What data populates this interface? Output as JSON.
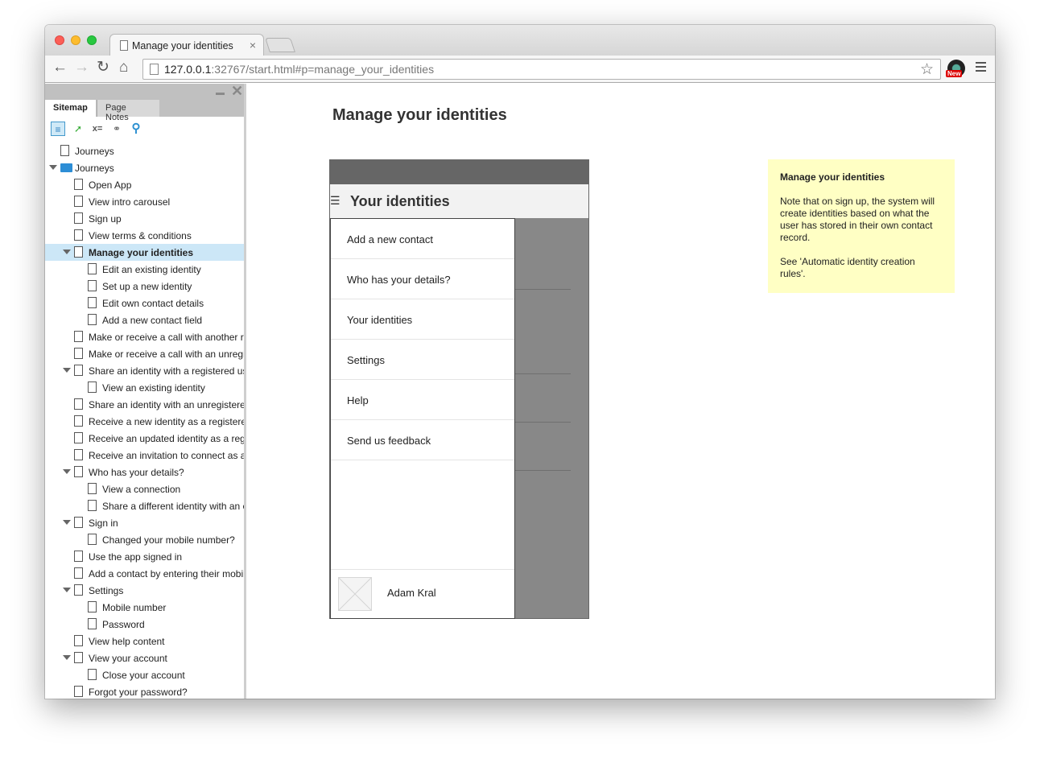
{
  "browser": {
    "tab_title": "Manage your identities",
    "tab_close": "×",
    "url_host": "127.0.0.1",
    "url_rest": ":32767/start.html#p=manage_your_identities",
    "back": "←",
    "forward": "→",
    "reload": "↻",
    "home": "⌂",
    "bookmark": "☆",
    "extension_badge": "New"
  },
  "sidebar": {
    "close": "✕",
    "tabs": [
      "Sitemap",
      "Page Notes"
    ],
    "tools": {
      "vars": "x=",
      "link": "⚭",
      "search": "⚲",
      "pages": "≡",
      "cursor": "➚"
    },
    "tree": [
      {
        "label": "Journeys",
        "level": 0,
        "icon": "page",
        "arrow": false
      },
      {
        "label": "Journeys",
        "level": 0,
        "icon": "folder",
        "arrow": true
      },
      {
        "label": "Open App",
        "level": 1,
        "icon": "page",
        "arrow": false
      },
      {
        "label": "View intro carousel",
        "level": 1,
        "icon": "page",
        "arrow": false
      },
      {
        "label": "Sign up",
        "level": 1,
        "icon": "page",
        "arrow": false
      },
      {
        "label": "View terms & conditions",
        "level": 1,
        "icon": "page",
        "arrow": false
      },
      {
        "label": "Manage your identities",
        "level": 1,
        "icon": "page",
        "arrow": true,
        "selected": true
      },
      {
        "label": "Edit an existing identity",
        "level": 2,
        "icon": "page",
        "arrow": false
      },
      {
        "label": "Set up a new identity",
        "level": 2,
        "icon": "page",
        "arrow": false
      },
      {
        "label": "Edit own contact details",
        "level": 2,
        "icon": "page",
        "arrow": false
      },
      {
        "label": "Add a new contact field",
        "level": 2,
        "icon": "page",
        "arrow": false
      },
      {
        "label": "Make or receive a call with another re",
        "level": 1,
        "icon": "page",
        "arrow": false
      },
      {
        "label": "Make or receive a call with an unregis",
        "level": 1,
        "icon": "page",
        "arrow": false
      },
      {
        "label": "Share an identity with a registered us",
        "level": 1,
        "icon": "page",
        "arrow": true
      },
      {
        "label": "View an existing identity",
        "level": 2,
        "icon": "page",
        "arrow": false
      },
      {
        "label": "Share an identity with an unregistere",
        "level": 1,
        "icon": "page",
        "arrow": false
      },
      {
        "label": "Receive a new identity as a registere",
        "level": 1,
        "icon": "page",
        "arrow": false
      },
      {
        "label": "Receive an updated identity as a regi",
        "level": 1,
        "icon": "page",
        "arrow": false
      },
      {
        "label": "Receive an invitation to connect as a",
        "level": 1,
        "icon": "page",
        "arrow": false
      },
      {
        "label": "Who has your details?",
        "level": 1,
        "icon": "page",
        "arrow": true
      },
      {
        "label": "View a connection",
        "level": 2,
        "icon": "page",
        "arrow": false
      },
      {
        "label": "Share a different identity with an e",
        "level": 2,
        "icon": "page",
        "arrow": false
      },
      {
        "label": "Sign in",
        "level": 1,
        "icon": "page",
        "arrow": true
      },
      {
        "label": "Changed your mobile number?",
        "level": 2,
        "icon": "page",
        "arrow": false
      },
      {
        "label": "Use the app signed in",
        "level": 1,
        "icon": "page",
        "arrow": false
      },
      {
        "label": "Add a contact by entering their mobile",
        "level": 1,
        "icon": "page",
        "arrow": false
      },
      {
        "label": "Settings",
        "level": 1,
        "icon": "page",
        "arrow": true
      },
      {
        "label": "Mobile number",
        "level": 2,
        "icon": "page",
        "arrow": false
      },
      {
        "label": "Password",
        "level": 2,
        "icon": "page",
        "arrow": false
      },
      {
        "label": "View help content",
        "level": 1,
        "icon": "page",
        "arrow": false
      },
      {
        "label": "View your account",
        "level": 1,
        "icon": "page",
        "arrow": true
      },
      {
        "label": "Close your account",
        "level": 2,
        "icon": "page",
        "arrow": false
      },
      {
        "label": "Forgot your password?",
        "level": 1,
        "icon": "page",
        "arrow": false
      }
    ]
  },
  "main": {
    "page_title": "Manage your identities",
    "phone": {
      "hamburger": "☰",
      "app_title": "Your identities",
      "menu_items": [
        "Add a new contact",
        "Who has your details?",
        "Your identities",
        "Settings",
        "Help",
        "Send us feedback"
      ],
      "user_name": "Adam Kral"
    },
    "note": {
      "title": "Manage your identities",
      "paragraphs": [
        "Note that on sign up, the system will create identities based on what the user has stored in their own contact record.",
        "See 'Automatic identity creation rules'."
      ]
    }
  }
}
